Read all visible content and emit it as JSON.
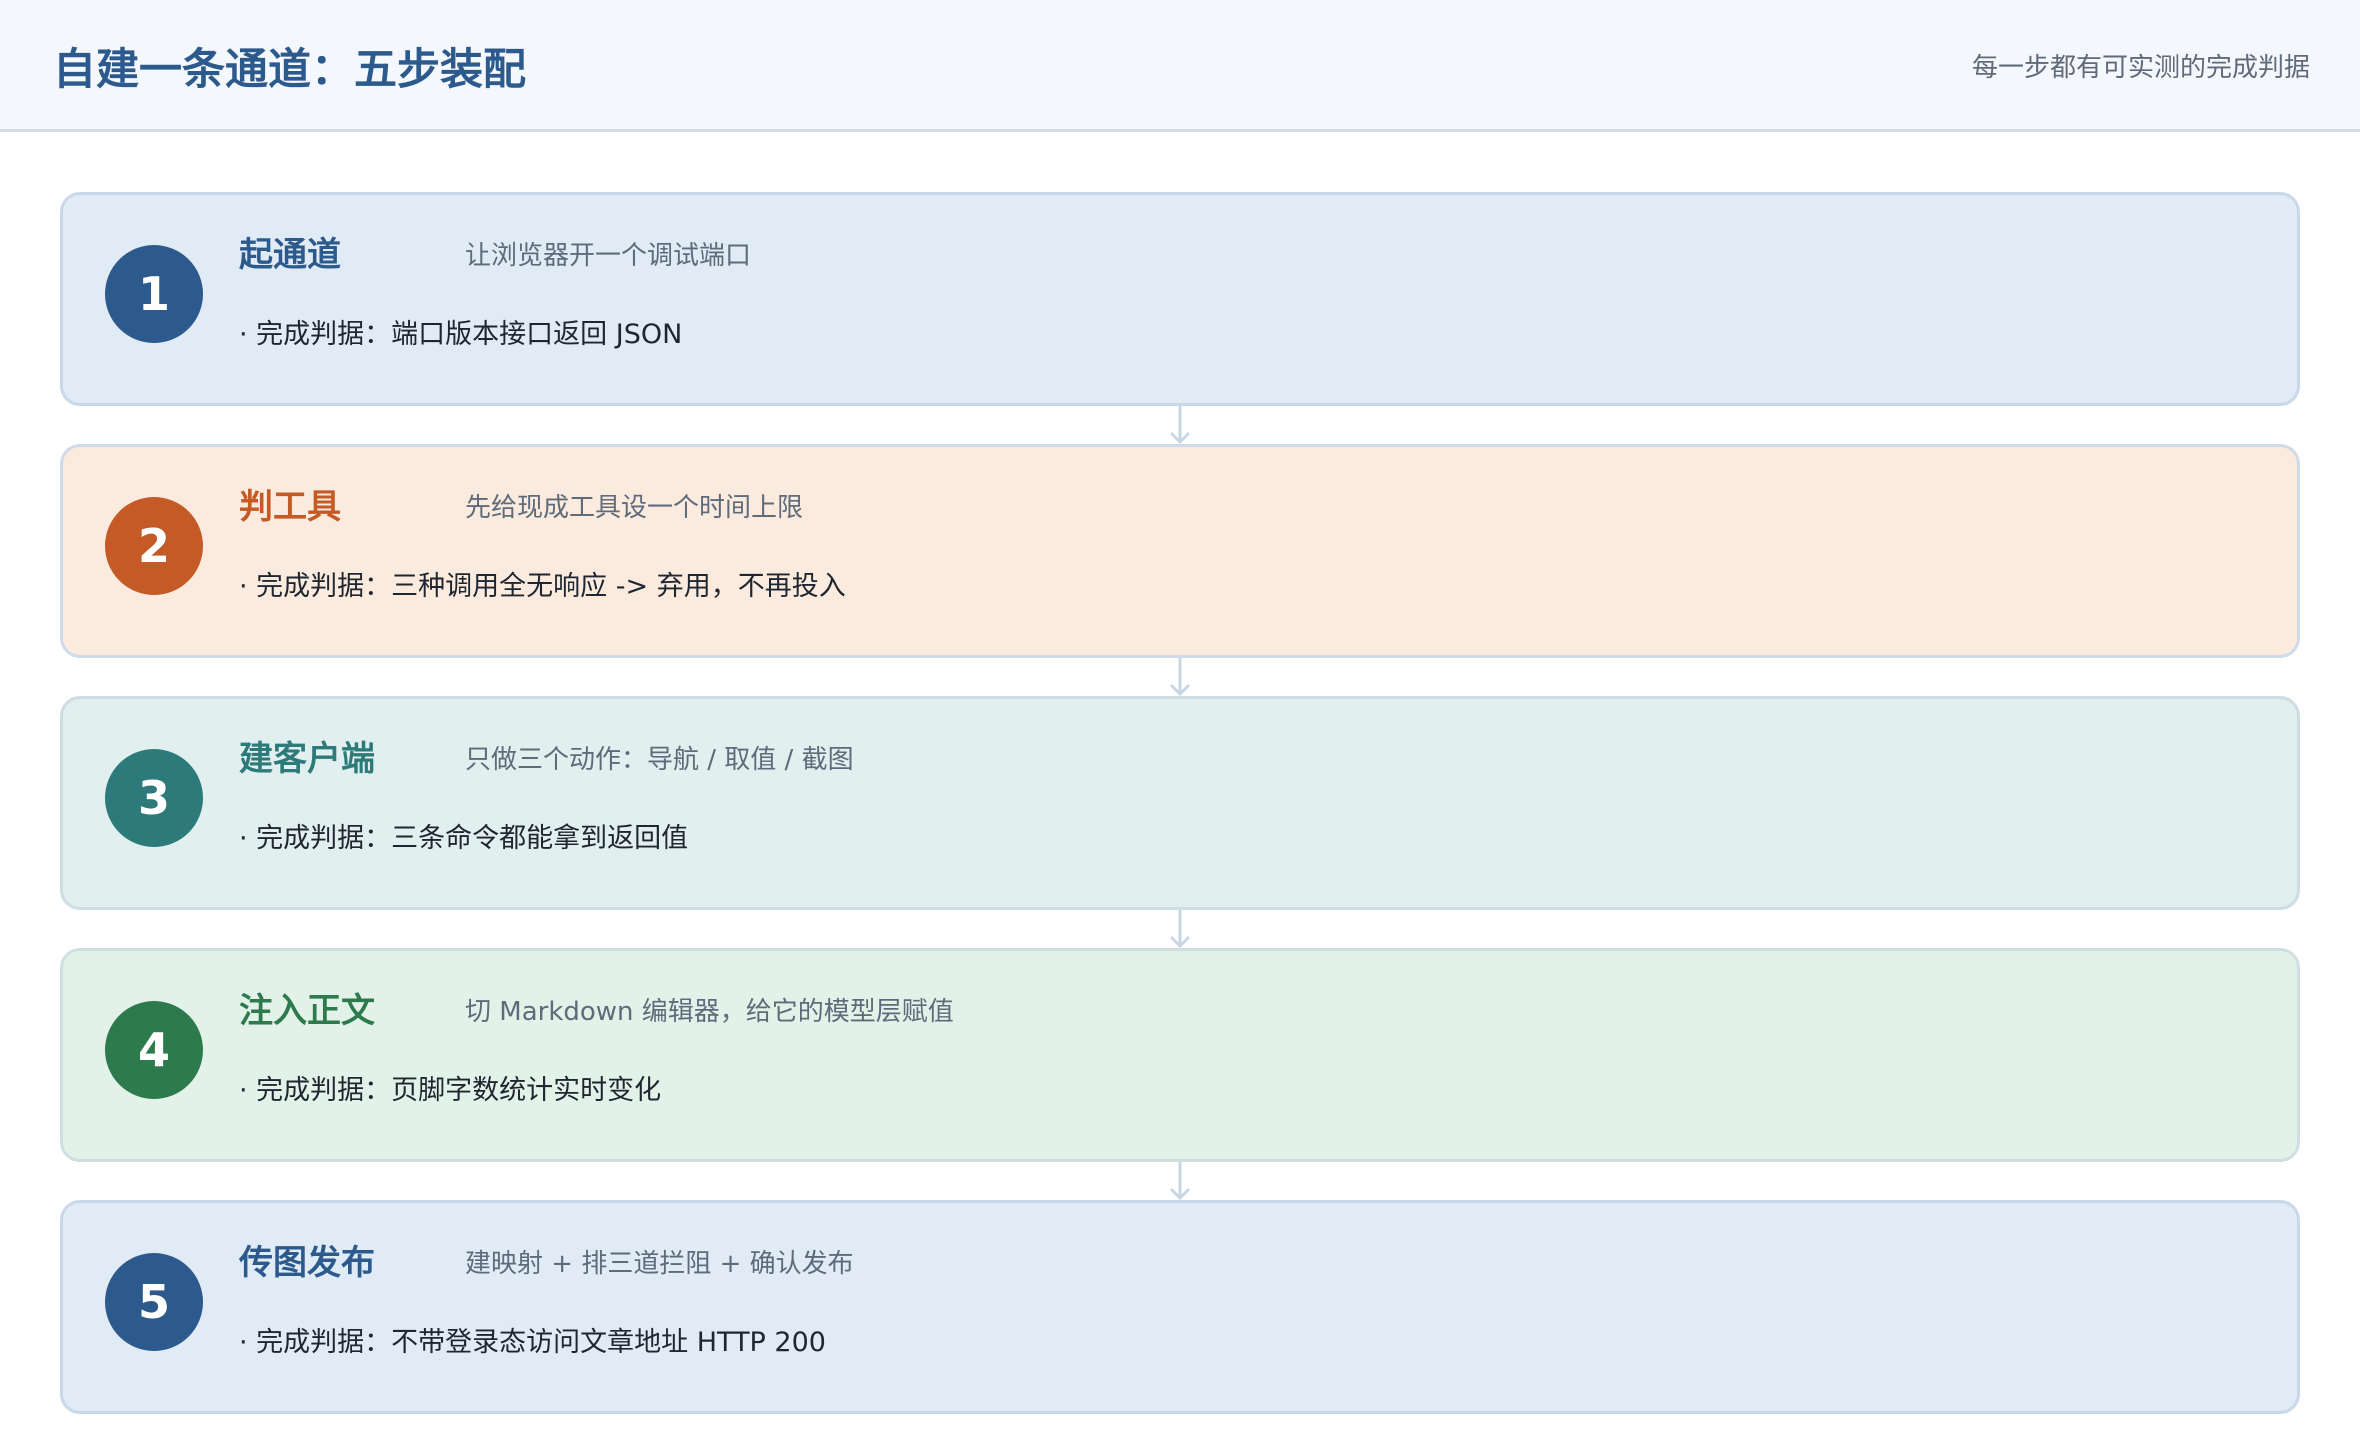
{
  "header": {
    "title": "自建一条通道：五步装配",
    "subtitle": "每一步都有可实测的完成判据"
  },
  "steps": [
    {
      "number": "1",
      "title": "起通道",
      "description": "让浏览器开一个调试端口",
      "criterion": "· 完成判据：端口版本接口返回 JSON",
      "accent": "#2c5a8c",
      "background": "#e1ebf6",
      "border": "#c9d8e8"
    },
    {
      "number": "2",
      "title": "判工具",
      "description": "先给现成工具设一个时间上限",
      "criterion": "· 完成判据：三种调用全无响应 -> 弃用，不再投入",
      "accent": "#c45a26",
      "background": "#fbebdf",
      "border": "#cfdbe8"
    },
    {
      "number": "3",
      "title": "建客户端",
      "description": "只做三个动作：导航 / 取值 / 截图",
      "criterion": "· 完成判据：三条命令都能拿到返回值",
      "accent": "#2c7b7a",
      "background": "#e1efee",
      "border": "#cddde4"
    },
    {
      "number": "4",
      "title": "注入正文",
      "description": "切 Markdown 编辑器，给它的模型层赋值",
      "criterion": "· 完成判据：页脚字数统计实时变化",
      "accent": "#2d7a4c",
      "background": "#e3f2e9",
      "border": "#cfdfe0"
    },
    {
      "number": "5",
      "title": "传图发布",
      "description": "建映射 + 排三道拦阻 + 确认发布",
      "criterion": "· 完成判据：不带登录态访问文章地址 HTTP 200",
      "accent": "#2c5a8c",
      "background": "#e1ebf6",
      "border": "#c9d8e8"
    }
  ]
}
